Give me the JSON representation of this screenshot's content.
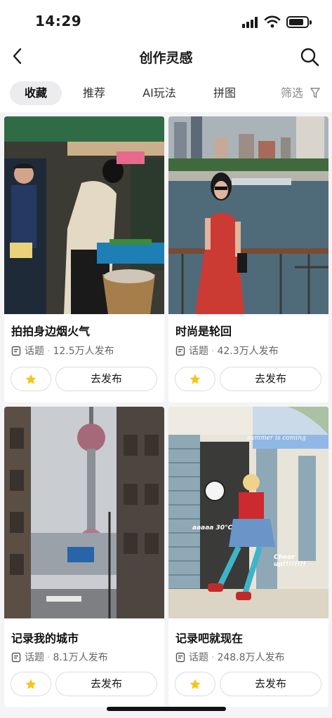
{
  "status_bar": {
    "time": "14:29"
  },
  "header": {
    "title": "创作灵感"
  },
  "tabs": [
    {
      "label": "收藏",
      "active": true
    },
    {
      "label": "推荐",
      "active": false
    },
    {
      "label": "AI玩法",
      "active": false
    },
    {
      "label": "拼图",
      "active": false
    }
  ],
  "filter": {
    "label": "筛选"
  },
  "cards": [
    {
      "title": "拍拍身边烟火气",
      "type": "话题",
      "count": "12.5万人发布",
      "action": "去发布"
    },
    {
      "title": "时尚是轮回",
      "type": "话题",
      "count": "42.3万人发布",
      "action": "去发布"
    },
    {
      "title": "记录我的城市",
      "type": "话题",
      "count": "8.1万人发布",
      "action": "去发布"
    },
    {
      "title": "记录吧就现在",
      "type": "话题",
      "count": "248.8万人发布",
      "action": "去发布"
    }
  ],
  "image_overlays": {
    "summer": "summer is coming",
    "temp": "aaaaa 30°C",
    "cheer": "Cheer up!!!!!!!!"
  },
  "colors": {
    "accent_star": "#f5c518",
    "background": "#f4f4f6",
    "active_tab_bg": "#ececee"
  }
}
